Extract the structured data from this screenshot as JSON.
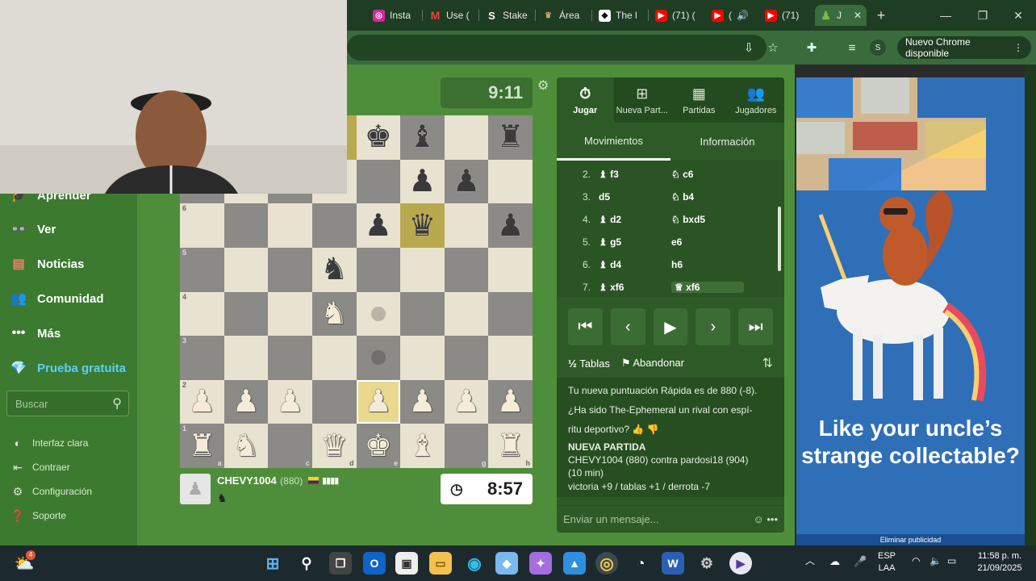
{
  "browser": {
    "tabs": [
      {
        "label": "Insta",
        "icon": "instagram-icon"
      },
      {
        "label": "Use (",
        "icon": "gmail-icon"
      },
      {
        "label": "Stake",
        "icon": "stake-icon"
      },
      {
        "label": "Área",
        "icon": "area-icon"
      },
      {
        "label": "The l",
        "icon": "notion-icon"
      },
      {
        "label": "(71) (",
        "icon": "youtube-icon"
      },
      {
        "label": "(",
        "icon": "youtube-icon"
      },
      {
        "label": "(71)",
        "icon": "youtube-icon"
      },
      {
        "label": "J",
        "icon": "chess-pawn-icon"
      }
    ],
    "update_label": "Nuevo Chrome disponible",
    "profile": "S"
  },
  "sidebar": {
    "items": [
      {
        "label": "Aprender",
        "icon": "mortarboard-icon"
      },
      {
        "label": "Ver",
        "icon": "binoculars-icon"
      },
      {
        "label": "Noticias",
        "icon": "newspaper-icon"
      },
      {
        "label": "Comunidad",
        "icon": "community-icon"
      },
      {
        "label": "Más",
        "icon": "more-icon"
      },
      {
        "label": "Prueba gratuita",
        "icon": "diamond-icon"
      }
    ],
    "search_placeholder": "Buscar",
    "footer": [
      {
        "label": "Interfaz clara",
        "icon": "contrast-icon"
      },
      {
        "label": "Contraer",
        "icon": "collapse-icon"
      },
      {
        "label": "Configuración",
        "icon": "gear-icon"
      },
      {
        "label": "Soporte",
        "icon": "help-icon"
      }
    ]
  },
  "game": {
    "opponent_clock": "9:11",
    "player_clock": "8:57",
    "player": {
      "name": "CHEVY1004",
      "rating": "(880)"
    },
    "ranks": [
      "6",
      "5",
      "4",
      "3",
      "2",
      "1"
    ],
    "files": [
      "a",
      "c",
      "d",
      "e",
      "g",
      "h"
    ]
  },
  "panel": {
    "tabs": [
      "Jugar",
      "Nueva Part...",
      "Partidas",
      "Jugadores"
    ],
    "subtabs": [
      "Movimientos",
      "Información"
    ],
    "moves": [
      {
        "n": "2.",
        "w": "f3",
        "b": "c6"
      },
      {
        "n": "3.",
        "w": "d5",
        "b": "b4"
      },
      {
        "n": "4.",
        "w": "d2",
        "b": "bxd5"
      },
      {
        "n": "5.",
        "w": "g5",
        "b": "e6"
      },
      {
        "n": "6.",
        "w": "d4",
        "b": "h6"
      },
      {
        "n": "7.",
        "w": "xf6",
        "b": "xf6"
      }
    ],
    "draw_label": "Tablas",
    "resign_label": "Abandonar",
    "chat": {
      "line1": "Tu nueva puntuación Rápida es de 880 (-8).",
      "line2": "¿Ha sido The-Ephemeral un rival con espí-",
      "line3": "ritu deportivo?",
      "new_game": "NUEVA PARTIDA",
      "matchup": "CHEVY1004 (880) contra pardosi18 (904)",
      "time": "(10 min)",
      "stats": "victoria +9 / tablas +1 / derrota -7"
    },
    "chat_placeholder": "Enviar un mensaje..."
  },
  "ad": {
    "headline": "Like your uncle’s strange collectable?",
    "remove": "Eliminar publicidad"
  },
  "taskbar": {
    "lang": "ESP",
    "lang2": "LAA",
    "time": "11:58 p. m.",
    "date": "21/09/2025",
    "badge": "4"
  },
  "colors": {
    "accent": "#3a6b3c",
    "page": "#4e8e3b",
    "trial": "#5cd0f2"
  }
}
